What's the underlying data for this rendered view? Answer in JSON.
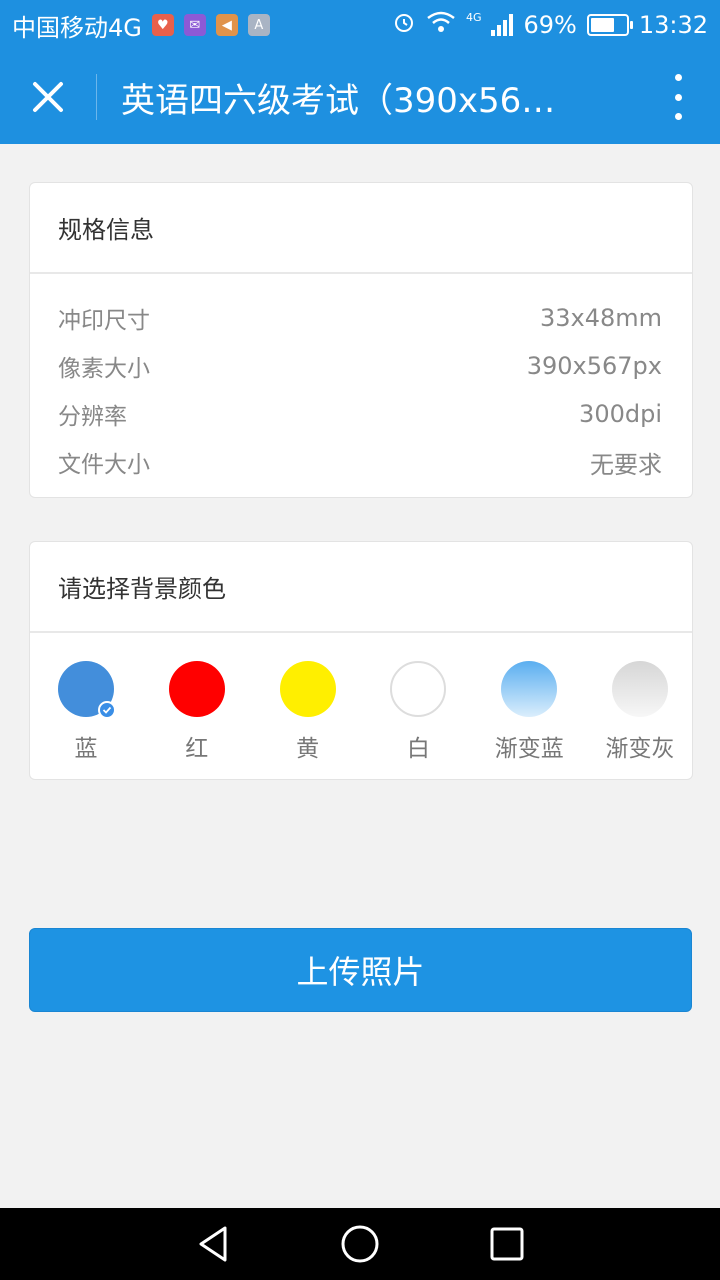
{
  "status_bar": {
    "carrier": "中国移动4G",
    "network": "4G",
    "battery": "69%",
    "battery_level": 0.69,
    "time": "13:32",
    "notification_icons": [
      "app-red-icon",
      "app-purple-icon",
      "app-orange-icon",
      "app-gray-icon"
    ]
  },
  "title_bar": {
    "title": "英语四六级考试（390x567...",
    "close_icon": "close-icon",
    "more_icon": "more-vertical-icon"
  },
  "spec_card": {
    "heading": "规格信息",
    "rows": [
      {
        "label": "冲印尺寸",
        "value": "33x48mm"
      },
      {
        "label": "像素大小",
        "value": "390x567px"
      },
      {
        "label": "分辨率",
        "value": "300dpi"
      },
      {
        "label": "文件大小",
        "value": "无要求"
      }
    ]
  },
  "color_card": {
    "heading": "请选择背景颜色",
    "colors": [
      {
        "label": "蓝",
        "color": "#438edb",
        "selected": true
      },
      {
        "label": "红",
        "color": "#ff0000",
        "selected": false
      },
      {
        "label": "黄",
        "color": "#ffef00",
        "selected": false
      },
      {
        "label": "白",
        "color": "#ffffff",
        "selected": false
      },
      {
        "label": "渐变蓝",
        "color": "#5fb4f2",
        "selected": false
      },
      {
        "label": "渐变灰",
        "color": "#d9d9d9",
        "selected": false
      }
    ]
  },
  "upload_button": {
    "label": "上传照片"
  },
  "nav_bar": {
    "back_icon": "back-triangle-icon",
    "home_icon": "home-circle-icon",
    "recents_icon": "recents-square-icon"
  },
  "theme": {
    "primary": "#1e90e0",
    "background": "#f2f2f2"
  }
}
